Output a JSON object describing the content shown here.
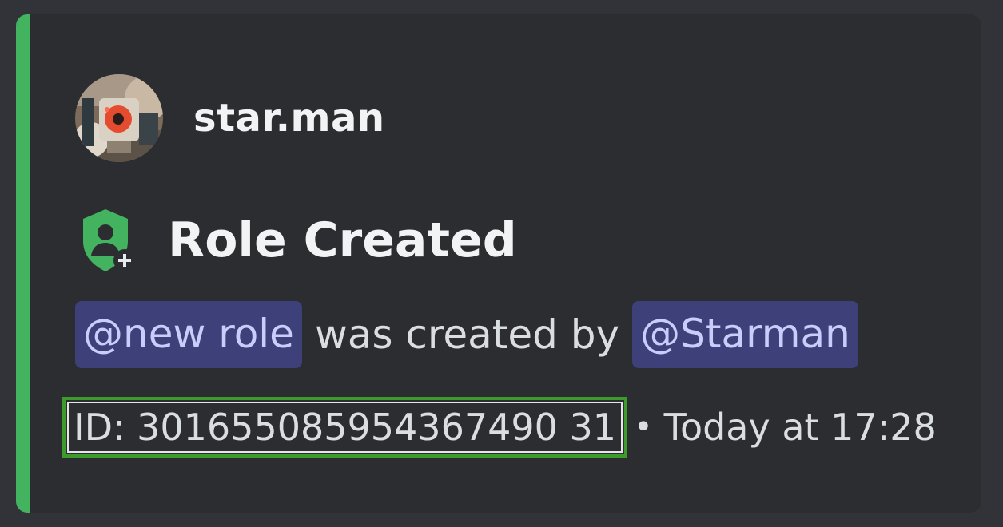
{
  "author": {
    "name": "star.man",
    "avatar_icon": "robot-avatar"
  },
  "embed": {
    "accent_color": "#43b360",
    "icon": "role-shield-add-icon",
    "title": "Role Created",
    "description": {
      "role_mention": "@new role",
      "text": "was created by",
      "user_mention": "@Starman"
    },
    "footer": {
      "id_text": "ID: 301655085954367490 31",
      "separator": "•",
      "timestamp": "Today at 17:28"
    }
  }
}
